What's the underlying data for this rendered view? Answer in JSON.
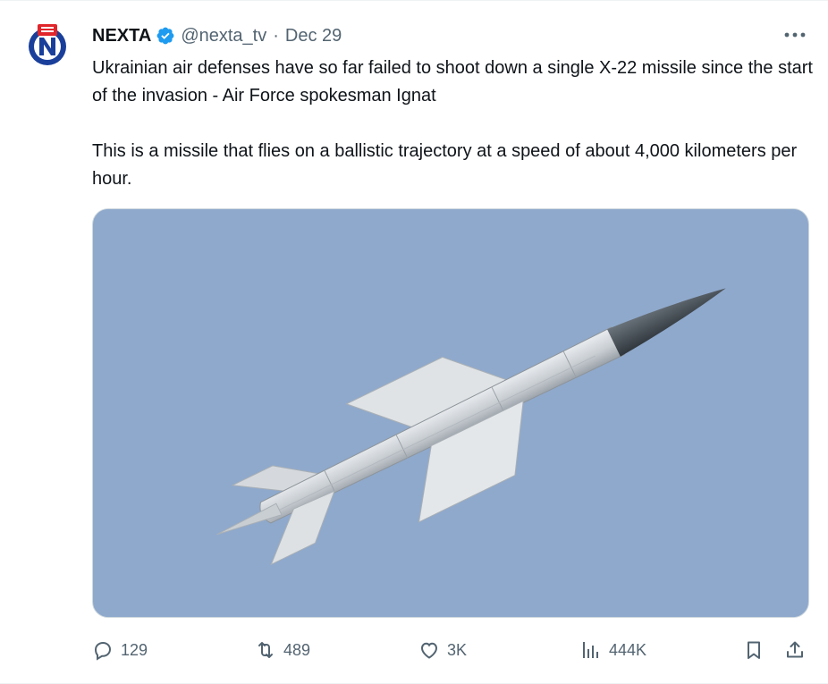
{
  "tweet": {
    "author": {
      "display_name": "NEXTA",
      "handle": "@nextа_tv",
      "verified": true,
      "avatar_icon": "nexta-logo"
    },
    "separator": "·",
    "date": "Dec 29",
    "text_paragraph_1": "Ukrainian air defenses have so far failed to shoot down a single X-22 missile since the start of the invasion - Air Force spokesman Ignat",
    "text_paragraph_2": "This is a missile that flies on a ballistic trajectory at a speed of about 4,000 kilometers per hour.",
    "media": {
      "image_icon": "missile-in-sky"
    },
    "actions": {
      "replies": "129",
      "reposts": "489",
      "likes": "3K",
      "views": "444K"
    }
  },
  "colors": {
    "accent": "#1d9bf0",
    "muted_text": "#536471",
    "sky": "#8fa9cc",
    "brand_red": "#e0252b",
    "brand_blue": "#1a3f9b"
  }
}
